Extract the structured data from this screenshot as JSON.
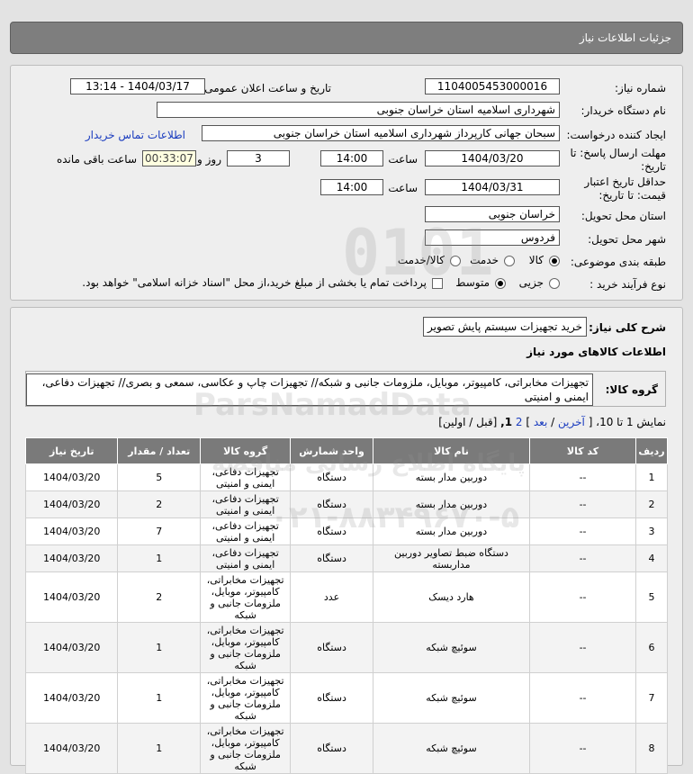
{
  "header": {
    "title": "جزئیات اطلاعات نیاز"
  },
  "form": {
    "need_number_label": "شماره نیاز:",
    "need_number": "1104005453000016",
    "announce_label": "تاریخ و ساعت اعلان عمومی:",
    "announce_value": "1404/03/17 - 13:14",
    "buyer_label": "نام دستگاه خریدار:",
    "buyer_value": "شهرداری اسلامیه استان خراسان جنوبی",
    "creator_label": "ایجاد کننده درخواست:",
    "creator_value": "سبحان جهانی کارپرداز شهرداری اسلامیه استان خراسان جنوبی",
    "contact_link": "اطلاعات تماس خریدار",
    "deadline_label": "مهلت ارسال پاسخ: تا تاریخ:",
    "deadline_date": "1404/03/20",
    "time_label": "ساعت",
    "deadline_time": "14:00",
    "days_value": "3",
    "days_label": "روز و",
    "remaining_value": "00:33:07",
    "remaining_label": "ساعت باقی مانده",
    "validity_label": "حداقل تاریخ اعتبار قیمت: تا تاریخ:",
    "validity_date": "1404/03/31",
    "validity_time_label": "ساعت",
    "validity_time": "14:00",
    "province_label": "استان محل تحویل:",
    "province_value": "خراسان جنوبی",
    "city_label": "شهر محل تحویل:",
    "city_value": "فردوس",
    "category_label": "طبقه بندی موضوعی:",
    "category_options": [
      "کالا",
      "خدمت",
      "کالا/خدمت"
    ],
    "category_selected": "کالا",
    "process_label": "نوع فرآیند خرید :",
    "process_options": [
      "جزیی",
      "متوسط"
    ],
    "process_selected": "متوسط",
    "payment_note": "پرداخت تمام یا بخشی از مبلغ خرید،از محل \"اسناد خزانه اسلامی\" خواهد بود."
  },
  "details": {
    "summary_label": "شرح کلی نیاز:",
    "summary_value": "خرید تجهیزات سیستم پایش تصویر",
    "goods_title": "اطلاعات کالاهای مورد نیاز",
    "group_label": "گروه کالا:",
    "group_value": "تجهیزات مخابراتی، کامپیوتر، موبایل، ملزومات جانبی و شبکه// تجهیزات چاپ و عکاسی، سمعی و بصری// تجهیزات دفاعی، ایمنی و امنیتی",
    "paging_prefix": "نمایش 1 تا 10، [",
    "paging_last": "آخرین",
    "paging_sep1": "/",
    "paging_next": "بعد",
    "paging_pages_prefix": "]",
    "paging_page2": "2",
    "paging_page1": "1,",
    "paging_tail": "[قبل / اولین]"
  },
  "table": {
    "headers": [
      "ردیف",
      "کد کالا",
      "نام کالا",
      "واحد شمارش",
      "گروه کالا",
      "تعداد / مقدار",
      "تاریخ نیاز"
    ],
    "rows": [
      [
        "1",
        "--",
        "دوربین مدار بسته",
        "دستگاه",
        "تجهیزات دفاعی، ایمنی و امنیتی",
        "5",
        "1404/03/20"
      ],
      [
        "2",
        "--",
        "دوربین مدار بسته",
        "دستگاه",
        "تجهیزات دفاعی، ایمنی و امنیتی",
        "2",
        "1404/03/20"
      ],
      [
        "3",
        "--",
        "دوربین مدار بسته",
        "دستگاه",
        "تجهیزات دفاعی، ایمنی و امنیتی",
        "7",
        "1404/03/20"
      ],
      [
        "4",
        "--",
        "دستگاه ضبط تصاویر دوربین مداربسته",
        "دستگاه",
        "تجهیزات دفاعی، ایمنی و امنیتی",
        "1",
        "1404/03/20"
      ],
      [
        "5",
        "--",
        "هارد دیسک",
        "عدد",
        "تجهیزات مخابراتی، کامپیوتر، موبایل، ملزومات جانبی و شبکه",
        "2",
        "1404/03/20"
      ],
      [
        "6",
        "--",
        "سوئیچ شبکه",
        "دستگاه",
        "تجهیزات مخابراتی، کامپیوتر، موبایل، ملزومات جانبی و شبکه",
        "1",
        "1404/03/20"
      ],
      [
        "7",
        "--",
        "سوئیچ شبکه",
        "دستگاه",
        "تجهیزات مخابراتی، کامپیوتر، موبایل، ملزومات جانبی و شبکه",
        "1",
        "1404/03/20"
      ],
      [
        "8",
        "--",
        "سوئیچ شبکه",
        "دستگاه",
        "تجهیزات مخابراتی، کامپیوتر، موبایل، ملزومات جانبی و شبکه",
        "1",
        "1404/03/20"
      ]
    ]
  },
  "watermark": {
    "number": "0101",
    "brand": "ParsNamadData",
    "phone": "۰۲۱-۸۸۳۴۹۶۷۰-۵",
    "tagline": "پایگاه اطلاع رسانی مناقصه"
  }
}
